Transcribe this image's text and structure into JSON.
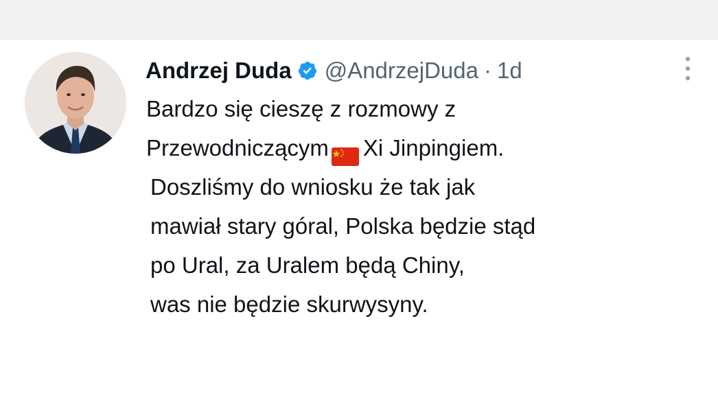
{
  "tweet": {
    "author": {
      "display_name": "Andrzej Duda",
      "handle": "@AndrzejDuda",
      "verified": true,
      "avatar": "profile-photo"
    },
    "separator": "·",
    "time": "1d",
    "more_icon": "vertical-ellipsis-icon",
    "text": {
      "line1": "Bardzo się cieszę z rozmowy z",
      "line2_before_flag": "Przewodniczącym",
      "flag": "china-flag-emoji",
      "line2_after_flag": "Xi Jinpingiem.",
      "line3": "Doszliśmy do wniosku że tak jak",
      "line4": "mawiał stary góral, Polska będzie stąd",
      "line5": "po Ural, za Uralem będą Chiny,",
      "line6": "was nie będzie skurwysyny."
    }
  },
  "colors": {
    "text": "#0f1419",
    "secondary": "#536471",
    "verified": "#1d9bf0",
    "flag_red": "#de2910",
    "flag_yellow": "#ffde00",
    "top_band": "#f2f2f2"
  }
}
